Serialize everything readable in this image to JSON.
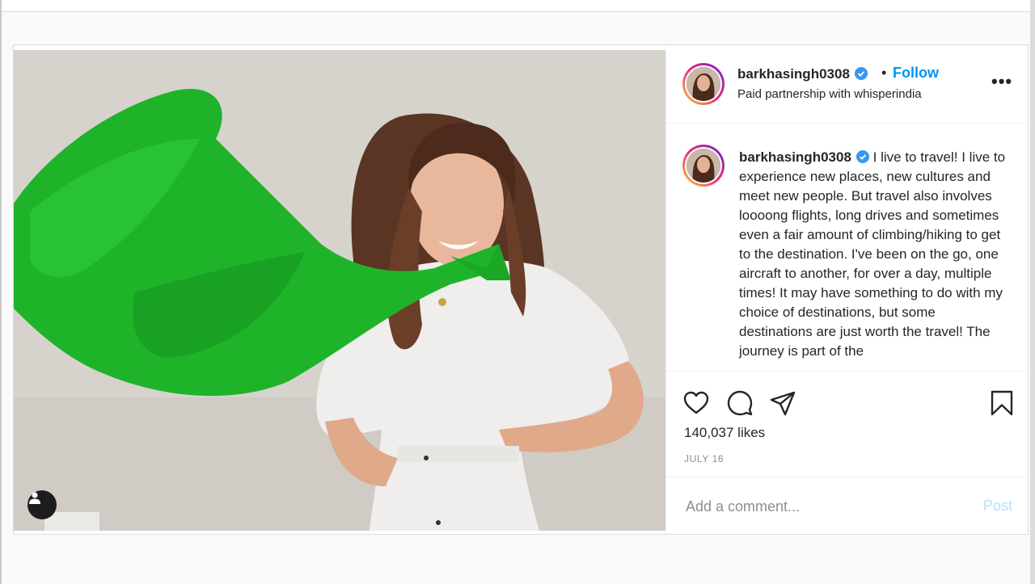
{
  "post": {
    "username": "barkhasingh0308",
    "follow_label": "Follow",
    "separator": "•",
    "partnership_text": "Paid partnership with whisperindia",
    "more_label": "•••",
    "caption_text": "I live to travel! I live to experience new places, new cultures and meet new people. But travel also involves loooong flights, long drives and sometimes even a fair amount of climbing/hiking to get to the destination. I've been on the go, one aircraft to another, for over a day, multiple times! It may have something to do with my choice of destinations, but some destinations are just worth the travel! The journey is part of the",
    "likes": "140,037 likes",
    "date": "JULY 16",
    "comment_placeholder": "Add a comment...",
    "post_label": "Post"
  },
  "icons": {
    "verified": "verified-badge-icon",
    "like": "heart-icon",
    "comment": "comment-bubble-icon",
    "share": "paper-plane-icon",
    "save": "bookmark-icon",
    "user_tag": "user-tag-icon"
  },
  "colors": {
    "accent": "#0095f6",
    "scarf": "#1fb32a",
    "post_disabled": "#b2dffc"
  }
}
